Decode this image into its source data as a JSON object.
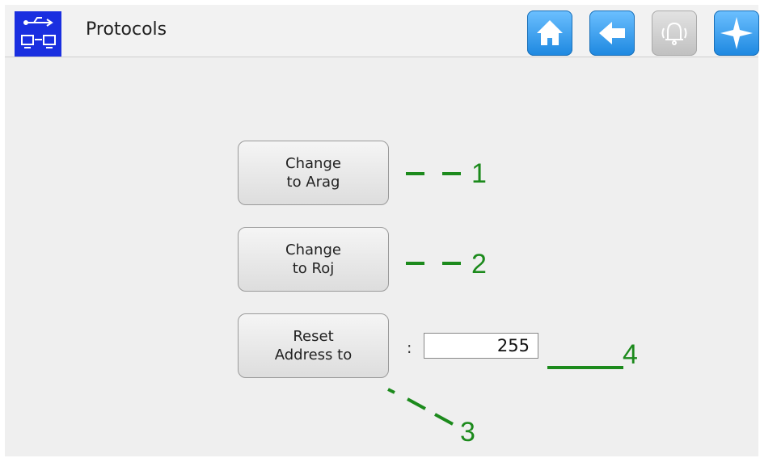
{
  "header": {
    "title": "Protocols",
    "icons": [
      "usb-network-icon",
      "home-icon",
      "back-arrow-icon",
      "alarm-bell-icon",
      "navigation-star-icon"
    ]
  },
  "buttons": {
    "change_arag": {
      "line1": "Change",
      "line2": "to Arag"
    },
    "change_roj": {
      "line1": "Change",
      "line2": "to Roj"
    },
    "reset_address": {
      "line1": "Reset",
      "line2": "Address to"
    }
  },
  "address": {
    "separator": ":",
    "value": "255"
  },
  "callouts": {
    "c1": "1",
    "c2": "2",
    "c3": "3",
    "c4": "4"
  },
  "colors": {
    "accent": "#1d88e0",
    "callout": "#1c8a1c",
    "app_icon_bg": "#1a2fe0"
  }
}
